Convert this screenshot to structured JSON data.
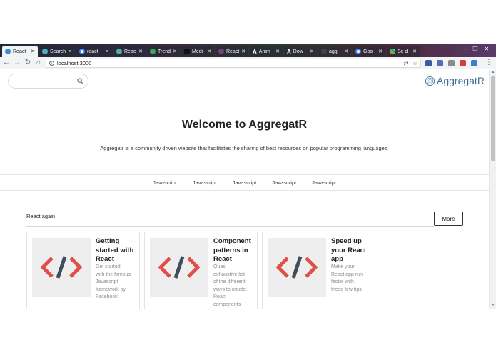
{
  "browser": {
    "tabs": [
      {
        "label": "React",
        "icon": "react-icon"
      },
      {
        "label": "Search",
        "icon": "search-tab-icon"
      },
      {
        "label": "react",
        "icon": "google-icon"
      },
      {
        "label": "React",
        "icon": "react-icon"
      },
      {
        "label": "Trend",
        "icon": "trend-icon"
      },
      {
        "label": "Medi",
        "icon": "medium-icon"
      },
      {
        "label": "React",
        "icon": "react-icon"
      },
      {
        "label": "Anim",
        "icon": "a-icon"
      },
      {
        "label": "Dow",
        "icon": "a-icon"
      },
      {
        "label": "agg",
        "icon": "agg-icon"
      },
      {
        "label": "Goo",
        "icon": "google-icon"
      },
      {
        "label": "Se d",
        "icon": "windows-icon"
      }
    ],
    "url": "localhost:3000"
  },
  "header": {
    "search_placeholder": "",
    "logo_text": "AggregatR"
  },
  "hero": {
    "title": "Welcome to AggregatR",
    "subtitle": "Aggregatr is a community driven website that facilitates the sharing of best resources on popular programming languages."
  },
  "topics": [
    "Javascript",
    "Javascript",
    "Javascript",
    "Javascript",
    "Javascript"
  ],
  "section": {
    "title": "React again",
    "more_label": "More"
  },
  "cards": [
    {
      "title_lines": [
        "Getting",
        "started with",
        "React"
      ],
      "desc_lines": [
        "Get started",
        "with the famous",
        "Javascript",
        "framework by",
        "Facebook"
      ]
    },
    {
      "title_lines": [
        "Component",
        "patterns in",
        "React"
      ],
      "desc_lines": [
        "Quasi",
        "exhaustive list",
        "of the different",
        "ways to create",
        "React",
        "components"
      ]
    },
    {
      "title_lines": [
        "Speed up",
        "your React",
        "app"
      ],
      "desc_lines": [
        "Make your",
        "React app run",
        "faster with",
        "these few tips"
      ]
    }
  ],
  "colors": {
    "accent": "#3b6f9a",
    "code_icon_red": "#e0504a",
    "code_icon_slash": "#3e4f5b"
  }
}
